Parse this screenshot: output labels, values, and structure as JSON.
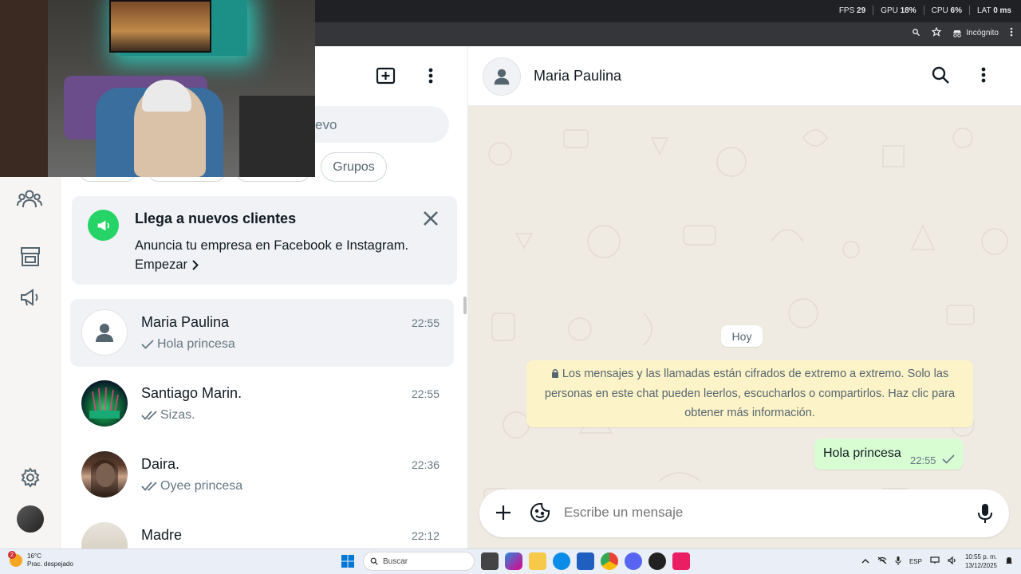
{
  "browser": {
    "perf": {
      "fps_label": "FPS",
      "fps_value": "29",
      "gpu_label": "GPU",
      "gpu_value": "18%",
      "cpu_label": "CPU",
      "cpu_value": "6%",
      "lat_label": "LAT",
      "lat_value": "0 ms"
    },
    "incognito_label": "Incógnito"
  },
  "colors": {
    "accent_green": "#25d366",
    "outgoing_bubble": "#d9fdd3",
    "notice_bg": "#fdf3c8",
    "chat_bg": "#efeae2"
  },
  "sidebar": {
    "search_partial": "evo",
    "filter_chip": "Grupos"
  },
  "promo": {
    "title": "Llega a nuevos clientes",
    "text": "Anuncia tu empresa en Facebook e Instagram.",
    "cta": "Empezar"
  },
  "chats": [
    {
      "name": "Maria Paulina",
      "time": "22:55",
      "last": "Hola princesa",
      "ticks": "single",
      "active": true,
      "avatar": "default"
    },
    {
      "name": "Santiago Marin.",
      "time": "22:55",
      "last": "Sizas.",
      "ticks": "double",
      "active": false,
      "avatar": "photo-green"
    },
    {
      "name": "Daira.",
      "time": "22:36",
      "last": "Oyee princesa",
      "ticks": "double",
      "active": false,
      "avatar": "photo-person"
    },
    {
      "name": "Madre",
      "time": "22:12",
      "last": "",
      "ticks": "none",
      "active": false,
      "avatar": "photo-light"
    }
  ],
  "conversation": {
    "contact_name": "Maria Paulina",
    "date_pill": "Hoy",
    "encryption_notice": "Los mensajes y las llamadas están cifrados de extremo a extremo. Solo las personas en este chat pueden leerlos, escucharlos o compartirlos. Haz clic para obtener más información.",
    "messages": [
      {
        "direction": "out",
        "text": "Hola princesa",
        "time": "22:55",
        "status": "sent"
      }
    ],
    "composer_placeholder": "Escribe un mensaje"
  },
  "taskbar": {
    "weather_temp": "16°C",
    "weather_desc": "Prac. despejado",
    "weather_badge": "2",
    "search_label": "Buscar",
    "lang": "ESP",
    "time": "10:55 p. m.",
    "date": "13/12/2025"
  }
}
